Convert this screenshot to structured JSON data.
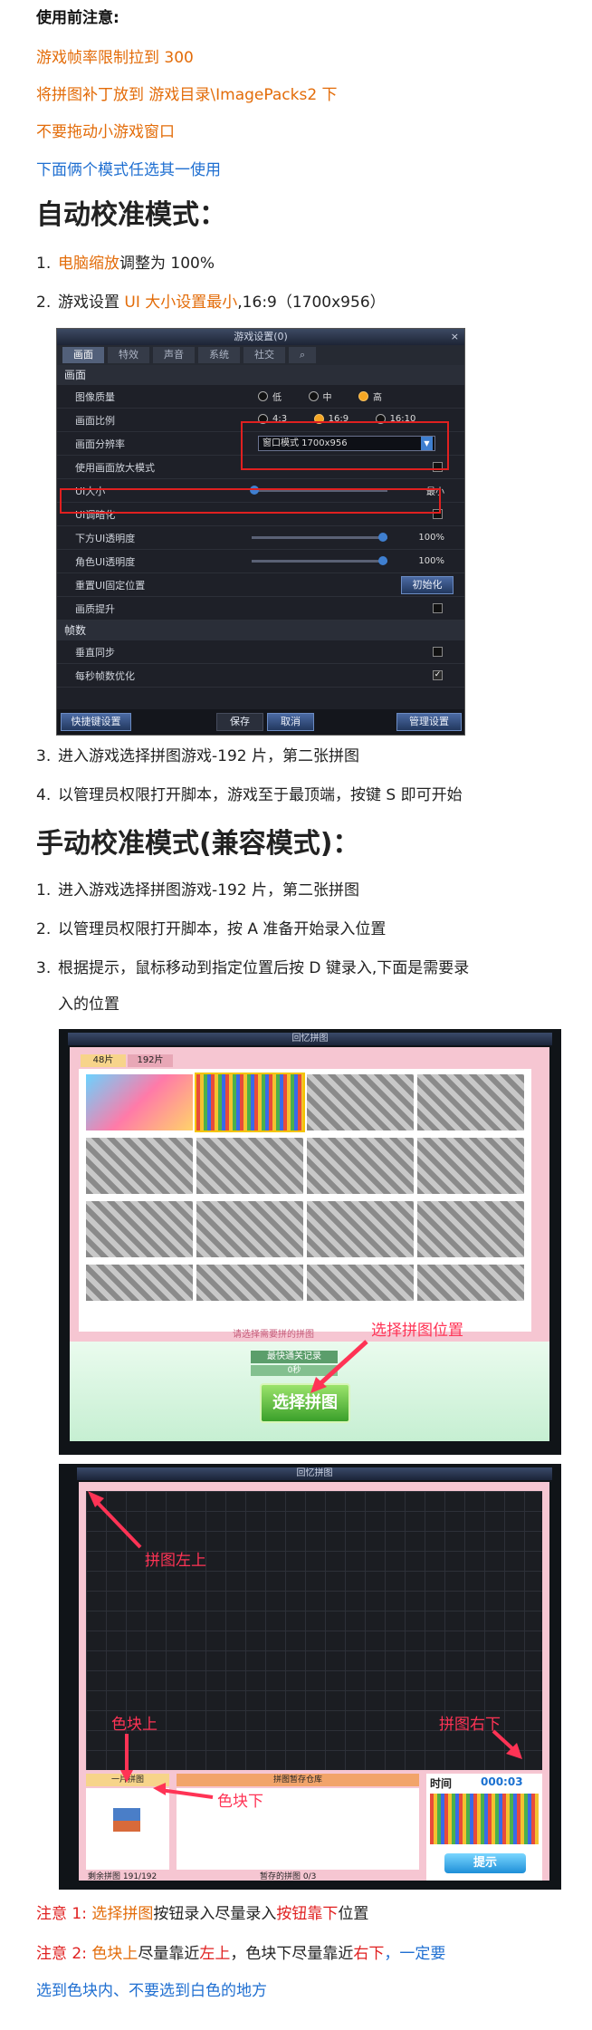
{
  "notes_heading": "使用前注意:",
  "notes": [
    "游戏帧率限制拉到 300",
    "将拼图补丁放到 游戏目录\\ImagePacks2 下",
    "不要拖动小游戏窗口",
    "下面俩个模式任选其一使用"
  ],
  "auto": {
    "title": "自动校准模式：",
    "step1_num": "1.",
    "step1_link": "电脑缩放",
    "step1_rest": "调整为 100%",
    "step2_num": "2.",
    "step2_a": "游戏设置 ",
    "step2_link": "UI 大小设置最小",
    "step2_rest": ",16:9（1700x956）",
    "step3_num": "3.",
    "step3": "进入游戏选择拼图游戏-192 片，第二张拼图",
    "step4_num": "4.",
    "step4": "以管理员权限打开脚本，游戏至于最顶端，按键 S  即可开始"
  },
  "settings": {
    "title": "游戏设置(0)",
    "close": "×",
    "tabs": [
      "画面",
      "特效",
      "声音",
      "系统",
      "社交"
    ],
    "search_icon": "search-icon",
    "section_display": "画面",
    "quality_label": "图像质量",
    "quality_opts": [
      "低",
      "中",
      "高"
    ],
    "ratio_label": "画面比例",
    "ratio_opts": [
      "4:3",
      "16:9",
      "16:10"
    ],
    "res_label": "画面分辨率",
    "res_value": "窗口模式 1700x956",
    "zoom_label": "使用画面放大模式",
    "ui_size_label": "UI大小",
    "ui_size_value": "最小",
    "ui_dark_label": "UI调暗化",
    "bottom_ui_label": "下方UI透明度",
    "bottom_ui_value": "100%",
    "char_ui_label": "角色UI透明度",
    "char_ui_value": "100%",
    "reset_ui_label": "重置UI固定位置",
    "reset_btn": "初始化",
    "boost_label": "画质提升",
    "section_fps": "帧数",
    "vsync_label": "垂直同步",
    "fps_opt_label": "每秒帧数优化",
    "shortcut_btn": "快捷键设置",
    "save_btn": "保存",
    "cancel_btn": "取消",
    "manage_btn": "管理设置"
  },
  "manual": {
    "title": "手动校准模式(兼容模式)：",
    "step1_num": "1.",
    "step1": "进入游戏选择拼图游戏-192 片，第二张拼图",
    "step2_num": "2.",
    "step2": "以管理员权限打开脚本，按 A 准备开始录入位置",
    "step3_num": "3.",
    "step3_a": "根据提示，鼠标移动到指定位置后按 D 键录入,下面是需要录",
    "step3_b": "入的位置"
  },
  "shot1": {
    "title": "回忆拼图",
    "tab1": "48片",
    "tab2": "192片",
    "hint": "请选择需要拼的拼图",
    "best_label": "最快通关记录",
    "best_value": "0秒",
    "select_btn": "选择拼图",
    "annotation": "选择拼图位置"
  },
  "shot2": {
    "title": "回忆拼图",
    "top_left": "拼图左上",
    "bottom_right": "拼图右下",
    "color_top": "色块上",
    "color_bottom": "色块下",
    "piece_label": "一片拼图",
    "warehouse": "拼图暂存仓库",
    "time_label": "时间",
    "time_value": "000:03",
    "remain": "剩余拼图 191/192",
    "stored": "暂存的拼图 0/3",
    "hint_btn": "提示"
  },
  "caution1": {
    "label": "注意 1:",
    "a": "选择拼图",
    "b": "按钮录入尽量录入",
    "c": "按钮靠下",
    "d": "位置"
  },
  "caution2": {
    "label": "注意 2:",
    "a": "色块上",
    "b": "尽量靠近",
    "c": "左上",
    "d": "，色块下尽量靠近",
    "e": "右下",
    "f": "，一定要",
    "g": "选到色块内、不要选到白色的地方"
  }
}
